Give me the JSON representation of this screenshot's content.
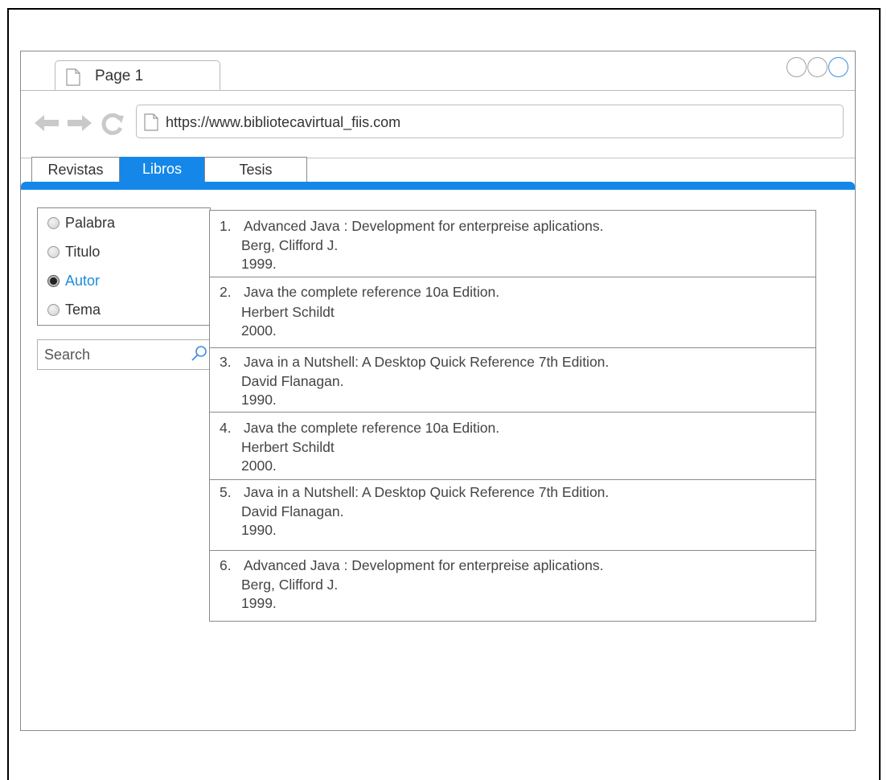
{
  "browser": {
    "tab_title": "Page 1",
    "url": "https://www.bibliotecavirtual_fiis.com"
  },
  "menu": {
    "tabs": [
      "Revistas",
      "Libros",
      "Tesis"
    ],
    "active": "Libros"
  },
  "filters": {
    "options": [
      "Palabra",
      "Titulo",
      "Autor",
      "Tema"
    ],
    "selected": "Autor"
  },
  "search": {
    "placeholder": "Search"
  },
  "results": [
    {
      "num": "1.",
      "title": "Advanced Java : Development for enterpreise aplications.",
      "author": "Berg, Clifford J.",
      "year": "1999."
    },
    {
      "num": "2.",
      "title": "Java the complete reference 10a Edition.",
      "author": "Herbert Schildt",
      "year": "2000."
    },
    {
      "num": "3.",
      "title": "Java in a Nutshell: A Desktop Quick Reference 7th Edition.",
      "author": "David Flanagan.",
      "year": "1990."
    },
    {
      "num": "4.",
      "title": "Java the complete reference 10a Edition.",
      "author": "Herbert Schildt",
      "year": "2000."
    },
    {
      "num": "5.",
      "title": "Java in a Nutshell: A Desktop Quick Reference 7th Edition.",
      "author": "David Flanagan.",
      "year": "1990."
    },
    {
      "num": "6.",
      "title": "Advanced Java : Development for enterpreise aplications.",
      "author": "Berg, Clifford J.",
      "year": "1999."
    }
  ],
  "colors": {
    "accent": "#1487e8",
    "selected_text": "#1a8fd8"
  }
}
